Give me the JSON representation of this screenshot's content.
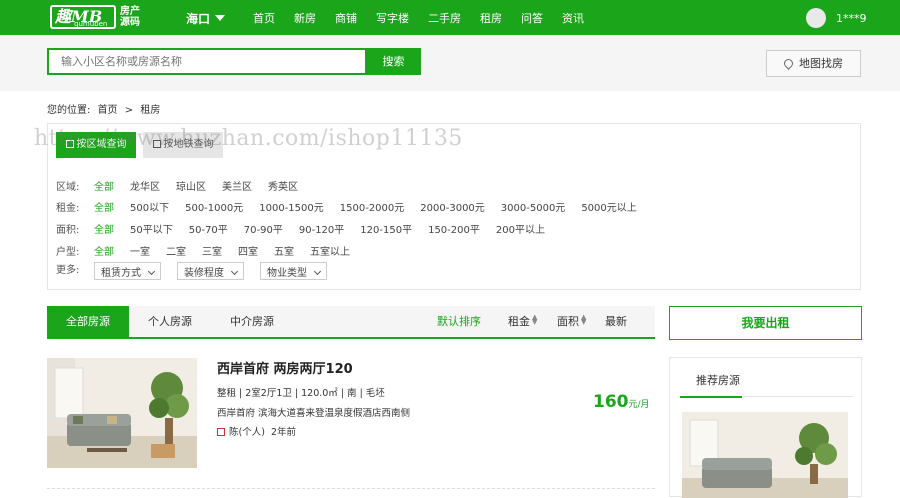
{
  "header": {
    "logo_mark": "趣MB",
    "logo_small": "qumuben",
    "logo_sub": "房产源码",
    "city": "海口",
    "nav": [
      "首页",
      "新房",
      "商铺",
      "写字楼",
      "二手房",
      "租房",
      "问答",
      "资讯"
    ],
    "user": "1***9",
    "colors": {
      "brand": "#1aa51a"
    }
  },
  "search": {
    "placeholder": "输入小区名称或房源名称",
    "button": "搜索",
    "map_button": "地图找房"
  },
  "breadcrumb": {
    "prefix": "您的位置:",
    "home": "首页",
    "sep": ">",
    "current": "租房"
  },
  "watermark": "https://www.huzhan.com/ishop11135",
  "filters": {
    "tab_district": "按区域查询",
    "tab_subway": "按地铁查询",
    "rows": [
      {
        "label": "区域:",
        "options": [
          "全部",
          "龙华区",
          "琼山区",
          "美兰区",
          "秀英区"
        ]
      },
      {
        "label": "租金:",
        "options": [
          "全部",
          "500以下",
          "500-1000元",
          "1000-1500元",
          "1500-2000元",
          "2000-3000元",
          "3000-5000元",
          "5000元以上"
        ]
      },
      {
        "label": "面积:",
        "options": [
          "全部",
          "50平以下",
          "50-70平",
          "70-90平",
          "90-120平",
          "120-150平",
          "150-200平",
          "200平以上"
        ]
      },
      {
        "label": "户型:",
        "options": [
          "全部",
          "一室",
          "二室",
          "三室",
          "四室",
          "五室",
          "五室以上"
        ]
      }
    ],
    "more_label": "更多:",
    "selects": [
      "租赁方式",
      "装修程度",
      "物业类型"
    ]
  },
  "list_tabs": [
    "全部房源",
    "个人房源",
    "中介房源"
  ],
  "sorts": [
    "默认排序",
    "租金",
    "面积",
    "最新"
  ],
  "rent_button": "我要出租",
  "listing": {
    "title": "西岸首府 两房两厅120",
    "meta": "整租 | 2室2厅1卫 | 120.0㎡ | 南 | 毛坯",
    "address": "西岸首府 滨海大道喜来登温泉度假酒店西南侧",
    "agent": "陈(个人)",
    "time": "2年前",
    "price": "160",
    "price_unit": "元/月"
  },
  "recommend": {
    "title": "推荐房源"
  }
}
